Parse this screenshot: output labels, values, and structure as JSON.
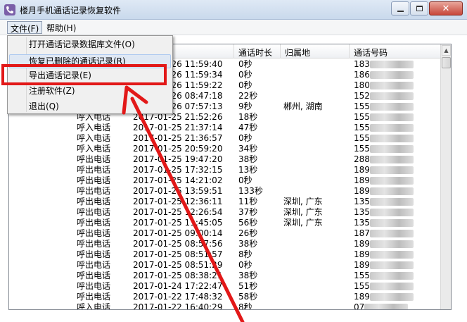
{
  "window": {
    "title": "楼月手机通话记录恢复软件"
  },
  "menubar": {
    "file": "文件(F)",
    "help": "帮助(H)"
  },
  "file_menu": {
    "items": [
      "打开通话记录数据库文件(O)",
      "恢复已删除的通话记录(R)",
      "导出通话记录(E)",
      "注册软件(Z)",
      "退出(Q)"
    ]
  },
  "columns": {
    "duration": "通话时长",
    "location": "归属地",
    "number": "通话号码"
  },
  "rows": [
    {
      "type": "",
      "time": "2017-01-26 11:59:40",
      "duration": "0秒",
      "location": "",
      "number": "183"
    },
    {
      "type": "",
      "time": "2017-01-26 11:59:34",
      "duration": "0秒",
      "location": "",
      "number": "186"
    },
    {
      "type": "",
      "time": "2017-01-26 11:59:22",
      "duration": "0秒",
      "location": "",
      "number": "180"
    },
    {
      "type": "",
      "time": "2017-01-26 08:47:18",
      "duration": "22秒",
      "location": "",
      "number": "152"
    },
    {
      "type": "",
      "time": "2017-01-26 07:57:13",
      "duration": "9秒",
      "location": "郴州, 湖南",
      "number": "155"
    },
    {
      "type": "呼入电话",
      "time": "2017-01-25 21:52:26",
      "duration": "18秒",
      "location": "",
      "number": "155"
    },
    {
      "type": "呼入电话",
      "time": "2017-01-25 21:37:14",
      "duration": "47秒",
      "location": "",
      "number": "155"
    },
    {
      "type": "呼入电话",
      "time": "2017-01-25 21:36:57",
      "duration": "0秒",
      "location": "",
      "number": "155"
    },
    {
      "type": "呼入电话",
      "time": "2017-01-25 20:59:20",
      "duration": "34秒",
      "location": "",
      "number": "155"
    },
    {
      "type": "呼出电话",
      "time": "2017-01-25 19:47:20",
      "duration": "38秒",
      "location": "",
      "number": "288"
    },
    {
      "type": "呼出电话",
      "time": "2017-01-25 17:32:15",
      "duration": "13秒",
      "location": "",
      "number": "189"
    },
    {
      "type": "呼出电话",
      "time": "2017-01-25 14:21:02",
      "duration": "0秒",
      "location": "",
      "number": "189"
    },
    {
      "type": "呼出电话",
      "time": "2017-01-25 13:59:51",
      "duration": "133秒",
      "location": "",
      "number": "189"
    },
    {
      "type": "呼出电话",
      "time": "2017-01-25 12:36:11",
      "duration": "11秒",
      "location": "深圳, 广东",
      "number": "135"
    },
    {
      "type": "呼出电话",
      "time": "2017-01-25 12:26:54",
      "duration": "37秒",
      "location": "深圳, 广东",
      "number": "135"
    },
    {
      "type": "呼出电话",
      "time": "2017-01-25 11:45:05",
      "duration": "56秒",
      "location": "深圳, 广东",
      "number": "135"
    },
    {
      "type": "呼出电话",
      "time": "2017-01-25 09:00:14",
      "duration": "26秒",
      "location": "",
      "number": "187"
    },
    {
      "type": "呼出电话",
      "time": "2017-01-25 08:57:56",
      "duration": "38秒",
      "location": "",
      "number": "189"
    },
    {
      "type": "呼出电话",
      "time": "2017-01-25 08:51:57",
      "duration": "8秒",
      "location": "",
      "number": "189"
    },
    {
      "type": "呼出电话",
      "time": "2017-01-25 08:51:29",
      "duration": "0秒",
      "location": "",
      "number": "189"
    },
    {
      "type": "呼出电话",
      "time": "2017-01-25 08:38:21",
      "duration": "38秒",
      "location": "",
      "number": "155"
    },
    {
      "type": "呼出电话",
      "time": "2017-01-24 17:22:47",
      "duration": "51秒",
      "location": "",
      "number": "155"
    },
    {
      "type": "呼出电话",
      "time": "2017-01-22 17:48:32",
      "duration": "58秒",
      "location": "",
      "number": "189"
    },
    {
      "type": "呼入电话",
      "time": "2017-01-22 16:40:29",
      "duration": "8秒",
      "location": "",
      "number": "07"
    }
  ],
  "colors": {
    "highlight_box": "#e21818",
    "arrow": "#e21818",
    "menu_hover": "#dfe8f4"
  },
  "icons": {
    "app": "phone-icon",
    "minimize": "minimize-icon",
    "maximize": "maximize-icon",
    "close": "close-icon"
  }
}
